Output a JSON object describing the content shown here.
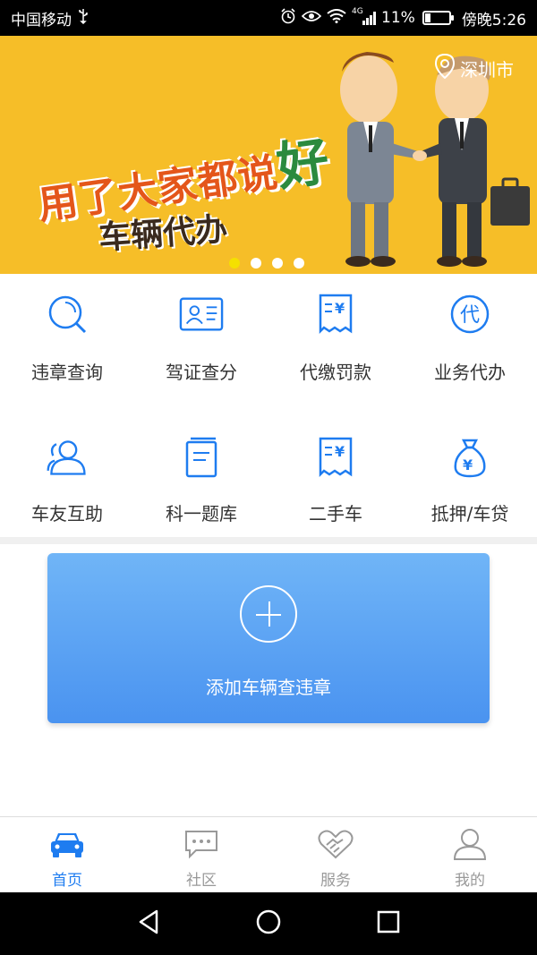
{
  "status_bar": {
    "carrier": "中国移动",
    "usb_icon": "usb-icon",
    "network": "4G",
    "battery_percent": "11%",
    "time": "傍晚5:26"
  },
  "banner": {
    "slogan_line1": "用了大家都说",
    "slogan_hao": "好",
    "slogan_line2": "车辆代办",
    "location": "深圳市",
    "active_slide": 0,
    "slide_count": 4
  },
  "services": [
    {
      "label": "违章查询",
      "icon": "search-icon"
    },
    {
      "label": "驾证查分",
      "icon": "id-card-icon"
    },
    {
      "label": "代缴罚款",
      "icon": "receipt-icon"
    },
    {
      "label": "业务代办",
      "icon": "agency-icon"
    },
    {
      "label": "车友互助",
      "icon": "users-icon"
    },
    {
      "label": "科一题库",
      "icon": "book-icon"
    },
    {
      "label": "二手车",
      "icon": "receipt-icon"
    },
    {
      "label": "抵押/车贷",
      "icon": "money-bag-icon"
    }
  ],
  "add_vehicle": {
    "label": "添加车辆查违章"
  },
  "tabs": [
    {
      "label": "首页",
      "icon": "car-icon",
      "active": true
    },
    {
      "label": "社区",
      "icon": "chat-icon",
      "active": false
    },
    {
      "label": "服务",
      "icon": "handshake-icon",
      "active": false
    },
    {
      "label": "我的",
      "icon": "user-icon",
      "active": false
    }
  ],
  "colors": {
    "accent": "#1e7cf0",
    "banner_bg": "#f6be28",
    "card_top": "#70b5f7",
    "card_bottom": "#4a93f0"
  }
}
